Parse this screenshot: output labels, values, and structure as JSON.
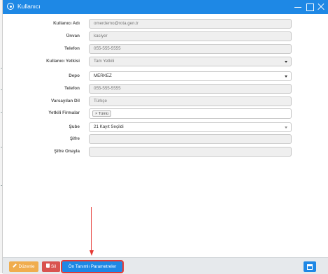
{
  "window": {
    "title": "Kullanıcı"
  },
  "form": {
    "username": {
      "label": "Kullanıcı Adı",
      "value": "omerdemo@rota.gen.tr"
    },
    "title": {
      "label": "Ünvan",
      "value": "kasiyer"
    },
    "phone": {
      "label": "Telefon",
      "value": "055-555-5555"
    },
    "authority": {
      "label": "Kullanıcı Yetkisi",
      "value": "Tam Yetkili"
    },
    "warehouse": {
      "label": "Depo",
      "value": "MERKEZ"
    },
    "phone2": {
      "label": "Telefon",
      "value": "055-555-5555"
    },
    "language": {
      "label": "Varsayılan Dil",
      "value": "Türkçe"
    },
    "companies": {
      "label": "Yetkili Firmalar",
      "tag": "× Tümü"
    },
    "branch": {
      "label": "Şube",
      "value": "21 Kayıt Seçildi"
    },
    "password": {
      "label": "Şifre",
      "value": ""
    },
    "password_confirm": {
      "label": "Şifre Onayla",
      "value": ""
    }
  },
  "footer": {
    "edit_label": "Düzenle",
    "delete_label": "Sil",
    "params_label": "Ön Tanımlı Parametreler"
  },
  "colors": {
    "accent": "#1e88e5",
    "edit": "#f0ad4e",
    "delete": "#d9534f",
    "highlight": "#e53935"
  }
}
